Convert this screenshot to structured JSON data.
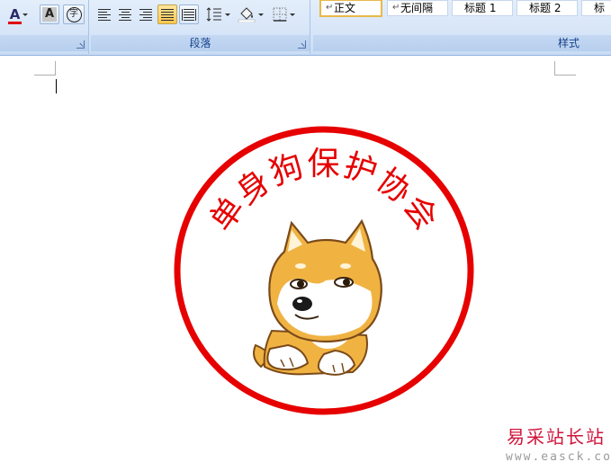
{
  "ribbon": {
    "font_group": {
      "font_color_icon": "A",
      "char_shading_icon": "A",
      "enclose_char_icon": "字",
      "font_color": "#e00000"
    },
    "paragraph_group": {
      "label": "段落"
    },
    "styles_group": {
      "label": "样式",
      "items": [
        {
          "label": "正文",
          "selected": true
        },
        {
          "label": "无间隔",
          "selected": false
        },
        {
          "label": "标题 1",
          "selected": false
        },
        {
          "label": "标题 2",
          "selected": false
        },
        {
          "label": "标",
          "selected": false
        }
      ]
    }
  },
  "document": {
    "seal": {
      "text": "单身狗保护协会",
      "color": "#e60000",
      "image": "shiba-dog-meme"
    }
  },
  "watermark": {
    "title": "易采站长站",
    "url": "www.easck.com",
    "color": "#d0143c"
  }
}
